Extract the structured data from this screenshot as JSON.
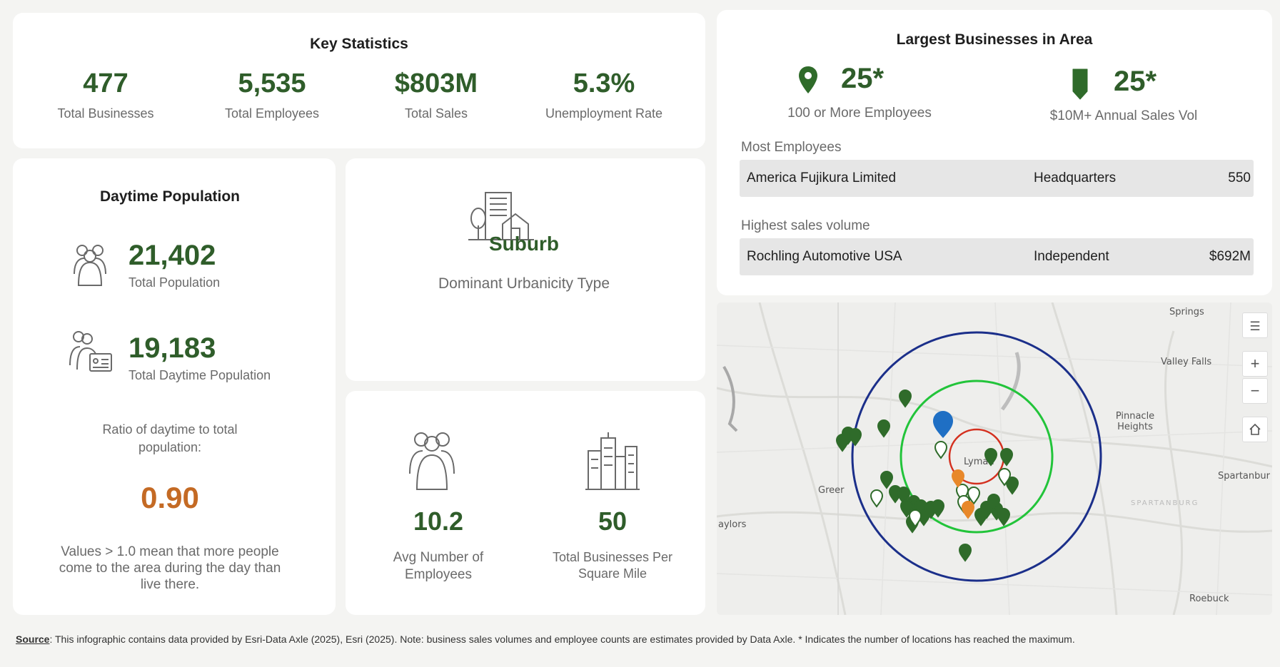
{
  "key_statistics": {
    "title": "Key Statistics",
    "stats": [
      {
        "value": "477",
        "label": "Total Businesses"
      },
      {
        "value": "5,535",
        "label": "Total Employees"
      },
      {
        "value": "$803M",
        "label": "Total Sales"
      },
      {
        "value": "5.3%",
        "label": "Unemployment Rate"
      }
    ]
  },
  "daytime_population": {
    "title": "Daytime Population",
    "total_population": {
      "value": "21,402",
      "label": "Total Population"
    },
    "daytime_population": {
      "value": "19,183",
      "label": "Total Daytime Population"
    },
    "ratio_label": "Ratio of daytime to total population:",
    "ratio_value": "0.90",
    "ratio_note": "Values > 1.0 mean that more people come to the area during the day than live there."
  },
  "urbanicity": {
    "value": "Suburb",
    "label": "Dominant Urbanicity Type"
  },
  "employees": {
    "value": "10.2",
    "label": "Avg Number of Employees"
  },
  "density": {
    "value": "50",
    "label": "Total Businesses Per Square Mile"
  },
  "largest_businesses": {
    "title": "Largest Businesses in Area",
    "employees_count": {
      "value": "25*",
      "label": "100 or More Employees"
    },
    "sales_count": {
      "value": "25*",
      "label": "$10M+ Annual Sales Vol"
    },
    "most_employees": {
      "heading": "Most Employees",
      "name": "America Fujikura Limited",
      "type": "Headquarters",
      "value": "550"
    },
    "highest_sales": {
      "heading": "Highest sales volume",
      "name": "Rochling Automotive USA",
      "type": "Independent",
      "value": "$692M"
    }
  },
  "map": {
    "places": {
      "springs": "Springs",
      "valley_falls": "Valley Falls",
      "pinnacle_heights": "Pinnacle Heights",
      "spartanburg": "Spartanbur",
      "spartanburg_county": "SPARTANBURG",
      "greer": "Greer",
      "lyman": "Lyman",
      "taylors": "aylors",
      "roebuck": "Roebuck"
    },
    "tools": {
      "zoom_in": "+",
      "zoom_out": "−"
    },
    "colors": {
      "ring_outer": "#1b2f8a",
      "ring_middle": "#22c43a",
      "ring_inner": "#d4301f",
      "pin_green": "#2f6b2a",
      "pin_orange": "#e8882a",
      "pin_center": "#1f6fc4"
    }
  },
  "footer": {
    "source_label": "Source",
    "text": ": This infographic contains data provided by Esri-Data Axle (2025), Esri (2025). Note: business sales volumes and employee counts are estimates provided by Data Axle. * Indicates the number of locations has reached the maximum."
  }
}
